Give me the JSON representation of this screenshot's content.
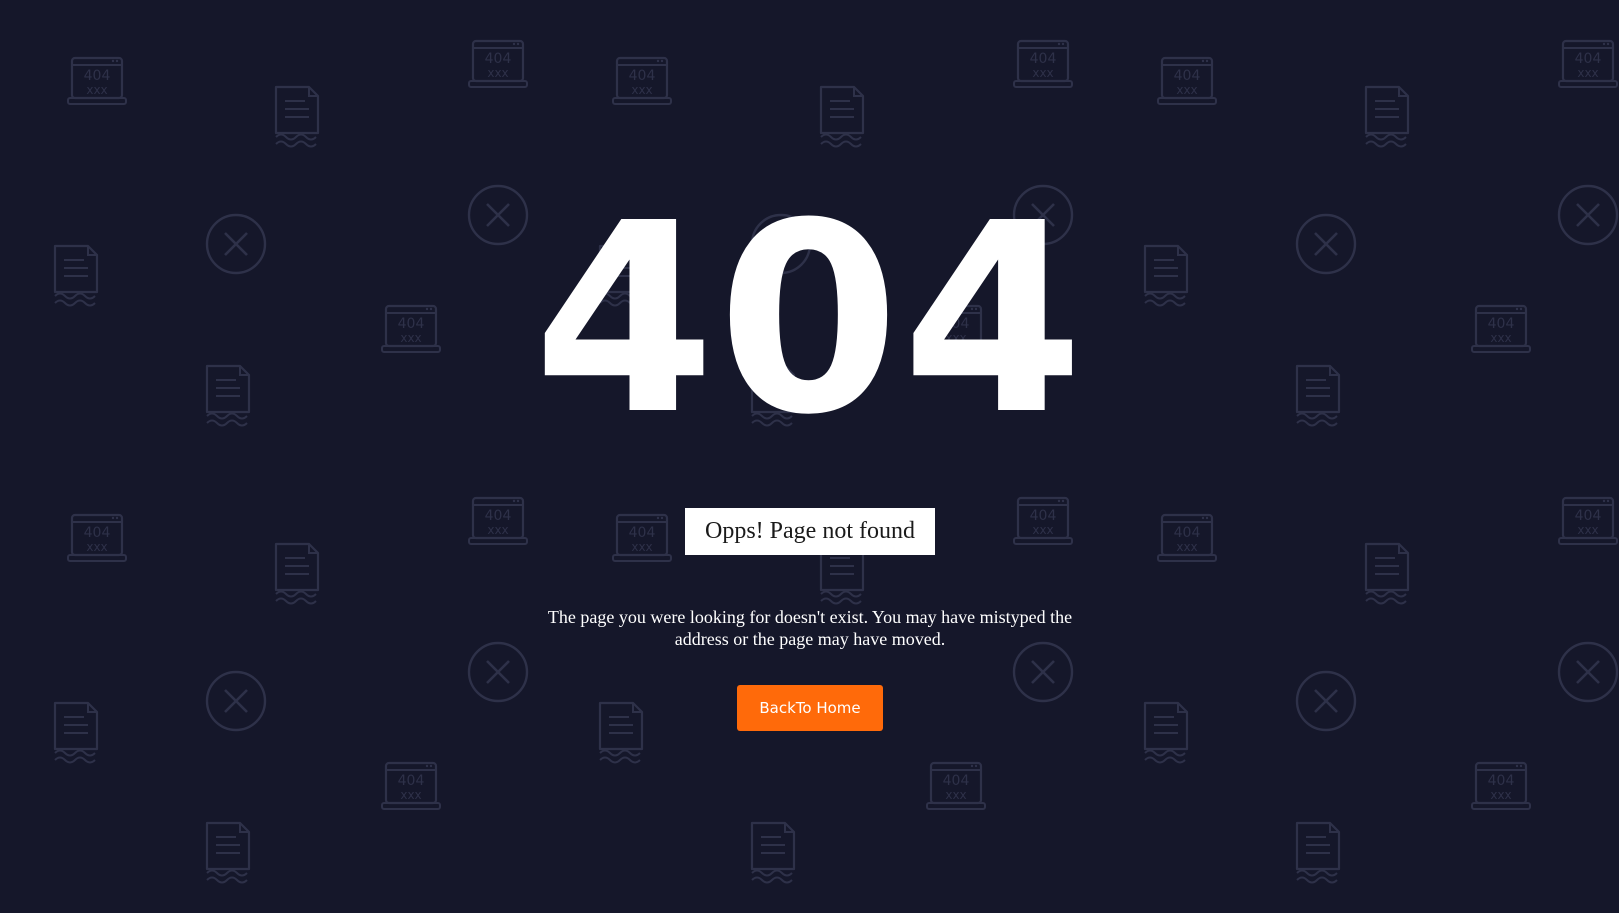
{
  "error": {
    "code": "404",
    "title": "Opps! Page not found",
    "description": "The page you were looking for doesn't exist. You may have mistyped the address or the page may have moved."
  },
  "actions": {
    "home_label": "BackTo Home"
  },
  "background": {
    "icon_label": "404",
    "icon_marks": "xxx",
    "icons": [
      "laptop-404-icon",
      "document-icon",
      "close-circle-icon"
    ]
  },
  "colors": {
    "background": "#15172a",
    "pattern": "#2a2d44",
    "accent": "#ff6a0a",
    "text": "#ffffff"
  }
}
